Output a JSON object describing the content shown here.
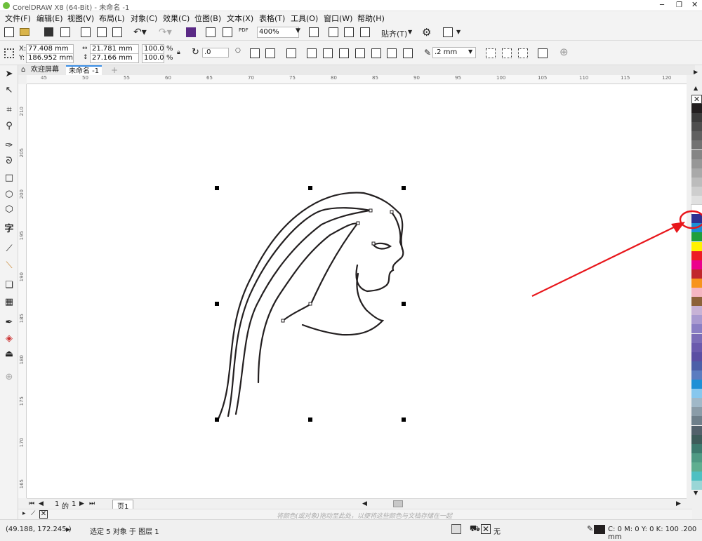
{
  "title_bar": {
    "title": "CorelDRAW X8 (64-Bit) - 未命名 -1"
  },
  "menu": [
    "文件(F)",
    "编辑(E)",
    "视图(V)",
    "布局(L)",
    "对象(C)",
    "效果(C)",
    "位图(B)",
    "文本(X)",
    "表格(T)",
    "工具(O)",
    "窗口(W)",
    "帮助(H)"
  ],
  "standard_toolbar": {
    "zoom": "400%",
    "snap_label": "贴齐(T)",
    "pdf_label": "PDF"
  },
  "property_bar": {
    "x_label": "X:",
    "x_value": "77.408 mm",
    "y_label": "Y:",
    "y_value": "186.952 mm",
    "width_value": "21.781 mm",
    "height_value": "27.166 mm",
    "scale_w": "100.0",
    "scale_h": "100.0",
    "percent": "%",
    "rotation": ".0",
    "outline_width": ".2 mm"
  },
  "doc_tabs": {
    "welcome": "欢迎屏幕",
    "document": "未命名 -1",
    "add": "+"
  },
  "ruler": {
    "h_ticks": [
      "45",
      "50",
      "55",
      "60",
      "65",
      "70",
      "75",
      "80",
      "85",
      "90",
      "95",
      "100",
      "105",
      "110",
      "115",
      "120"
    ],
    "v_ticks": [
      "210",
      "205",
      "200",
      "195",
      "190",
      "185",
      "180",
      "175",
      "170",
      "165"
    ]
  },
  "page_nav": {
    "current": "1",
    "of_label": "的",
    "total": "1",
    "page_tab": "页1"
  },
  "hint_text": "将颜色(或对象)拖动至此处，以便将这些颜色与文档存储在一起",
  "status": {
    "coords": "(49.188, 172.245 )",
    "selection": "选定 5 对象 于 图层 1",
    "fill_none": "无",
    "outline_info": "C: 0 M: 0 Y: 0 K: 100  .200 mm"
  },
  "colors": {
    "accent": "#1b8fd6",
    "annotation": "#e8161b",
    "palette": [
      "#231f20",
      "#3c3c3c",
      "#4e4e4e",
      "#606060",
      "#727272",
      "#858585",
      "#979797",
      "#a9a9a9",
      "#bcbcbc",
      "#cecece",
      "#e0e0e0",
      "#ffffff",
      "#2e3192",
      "#1b8fd6",
      "#1f9f3b",
      "#fff200",
      "#ed1c24",
      "#ec008c",
      "#c1272d",
      "#f7941d",
      "#f4b6c2",
      "#8c6239",
      "#c7b2d6",
      "#a99ad0",
      "#8a7fc4",
      "#7b6db8",
      "#6a5aad",
      "#5a4ea3",
      "#4c5fa8",
      "#5b7cc0",
      "#1e90d6",
      "#87c7ee",
      "#a0b8c8",
      "#8a9ca8",
      "#6e7f8a",
      "#53616b",
      "#3e5c5a",
      "#3d7a6e",
      "#4f9a84",
      "#5fae90",
      "#4ec0c2",
      "#9ad6d6"
    ]
  }
}
